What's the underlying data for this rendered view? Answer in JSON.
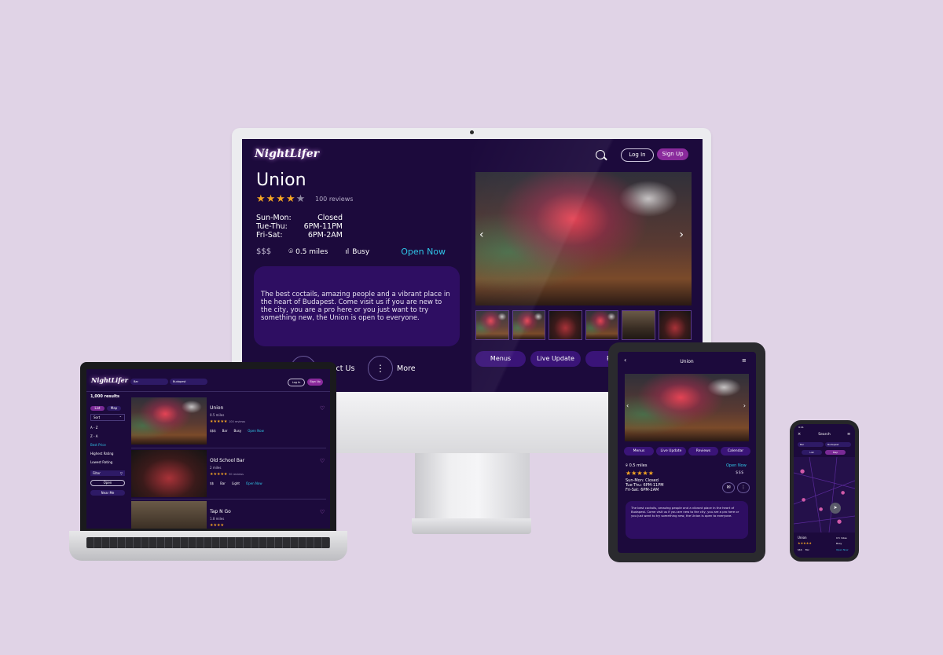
{
  "brand": {
    "logo_text": "NightLifer",
    "accent": "#8a2a9c",
    "background": "#1c0a3c",
    "open_color": "#2fc5e8"
  },
  "desktop": {
    "header": {
      "login_label": "Log In",
      "signup_label": "Sign Up"
    },
    "venue": {
      "name": "Union",
      "rating": 4,
      "stars_filled": "★★★★",
      "stars_empty": "★",
      "reviews": "100 reviews",
      "hours": [
        {
          "days": "Sun-Mon:",
          "time": "Closed"
        },
        {
          "days": "Tue-Thu:",
          "time": "6PM-11PM"
        },
        {
          "days": "Fri-Sat:",
          "time": "6PM-2AM"
        }
      ],
      "price": "$$$",
      "distance": "0.5 miles",
      "busy": "Busy",
      "status": "Open Now",
      "description": "The best coctails, amazing people and a vibrant place in the heart of Budapest. Come visit us if you are new to the city, you are a pro here or you just want to try something new, the Union is open to everyone."
    },
    "actions": {
      "contact_label": "tact Us",
      "more_label": "More"
    },
    "tabs": [
      "Menus",
      "Live Update",
      "Re"
    ]
  },
  "laptop": {
    "search": {
      "category": "Bar",
      "city": "Budapest"
    },
    "login_label": "Log In",
    "signup_label": "Sign Up",
    "results_count": "1,000 results",
    "view_toggle": [
      "List",
      "Map"
    ],
    "sort_label": "Sort",
    "sort_options": [
      "A - Z",
      "Z - A",
      "Best Price",
      "Highest Rating",
      "Lowest Rating"
    ],
    "filter_label": "Filter",
    "open_label": "Open",
    "near_me_label": "Near Me",
    "results": [
      {
        "name": "Union",
        "distance": "0.5 miles",
        "stars": "★★★★★",
        "reviews": "100 reviews",
        "price": "$$$",
        "type": "Bar",
        "busy": "Busy",
        "status": "Open Now"
      },
      {
        "name": "Old School Bar",
        "distance": "2 miles",
        "stars": "★★★★★",
        "reviews": "30 reviews",
        "price": "$$",
        "type": "Bar",
        "busy": "Light",
        "status": "Open Now"
      },
      {
        "name": "Tap N Go",
        "distance": "1.8 miles",
        "stars": "★★★★",
        "reviews": "",
        "price": "",
        "type": "",
        "busy": "",
        "status": ""
      }
    ]
  },
  "tablet": {
    "title": "Union",
    "tabs": [
      "Menus",
      "Live Update",
      "Reviews",
      "Calendar"
    ],
    "distance": "0.5 miles",
    "status": "Open Now",
    "stars": "★★★★★",
    "price": "$$$",
    "hours": [
      "Sun-Mon: Closed",
      "Tue-Thu: 6PM-11PM",
      "Fri-Sat: 6PM-2AM"
    ],
    "description": "The best coctails, amazing people and a vibrant place in the heart of Budapest. Come visit us if you are new to the city, you are a pro here or you just want to try something new, the Union is open to everyone."
  },
  "phone": {
    "time": "9:41",
    "title": "Search",
    "search": {
      "category": "Bar",
      "city": "Budapest"
    },
    "view_toggle": [
      "List",
      "Map"
    ],
    "card": {
      "name": "Union",
      "distance": "0.5 miles",
      "stars": "★★★★★",
      "busy": "Busy",
      "price": "$$$",
      "type": "Bar",
      "status": "Open Now"
    }
  }
}
